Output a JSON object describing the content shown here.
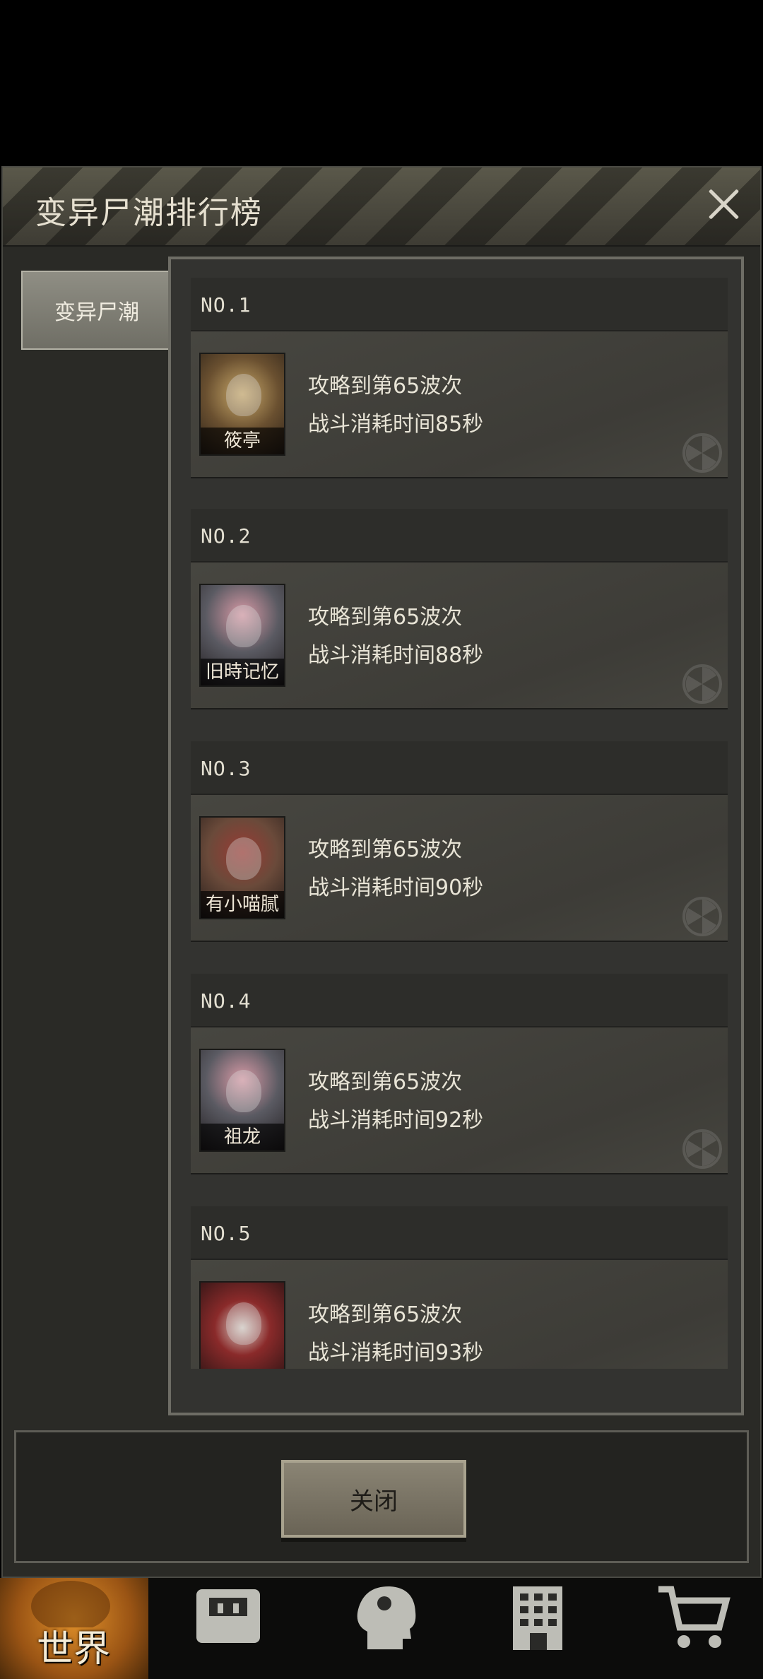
{
  "modal": {
    "title": "变异尸潮排行榜",
    "close_icon": "close-icon",
    "tab_label": "变异尸潮"
  },
  "ranks": [
    {
      "rank": "NO.1",
      "player": "筱亭",
      "wave": "攻略到第65波次",
      "time": "战斗消耗时间85秒"
    },
    {
      "rank": "NO.2",
      "player": "旧時记忆",
      "wave": "攻略到第65波次",
      "time": "战斗消耗时间88秒"
    },
    {
      "rank": "NO.3",
      "player": "有小喵腻",
      "wave": "攻略到第65波次",
      "time": "战斗消耗时间90秒"
    },
    {
      "rank": "NO.4",
      "player": "祖龙",
      "wave": "攻略到第65波次",
      "time": "战斗消耗时间92秒"
    },
    {
      "rank": "NO.5",
      "player": "",
      "wave": "攻略到第65波次",
      "time": "战斗消耗时间93秒"
    }
  ],
  "footer": {
    "close_label": "关闭"
  },
  "bottom_nav": {
    "world_label": "世界",
    "icons": [
      "world-icon",
      "backpack-icon",
      "head-icon",
      "building-icon",
      "cart-icon"
    ]
  }
}
